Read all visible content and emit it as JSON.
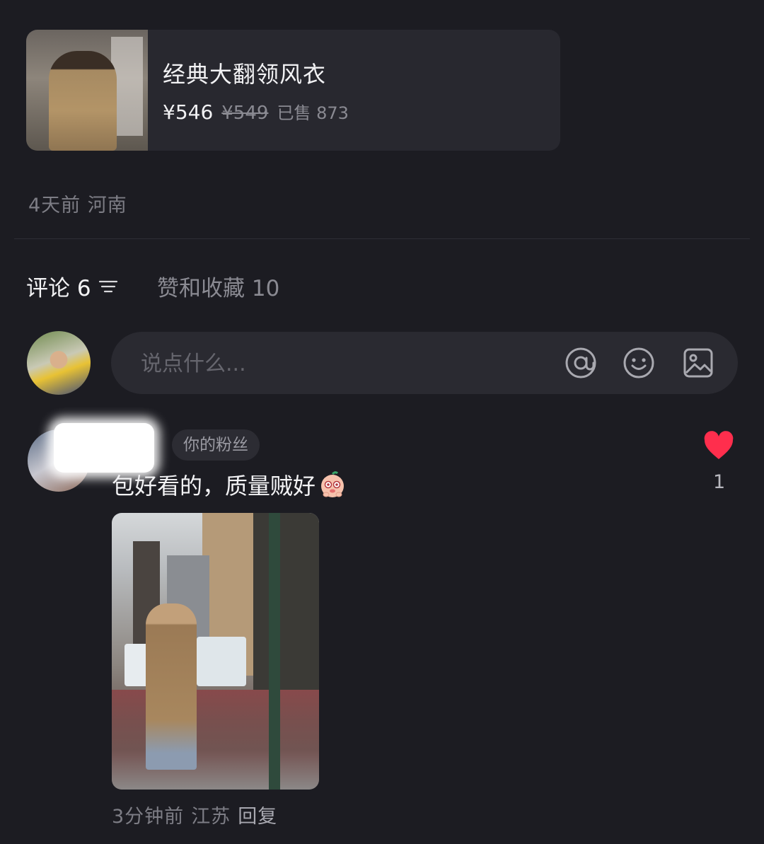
{
  "product": {
    "title": "经典大翻领风衣",
    "price": "¥546",
    "original_price": "¥549",
    "sold": "已售 873"
  },
  "post_meta": {
    "time": "4天前",
    "location": "河南"
  },
  "tabs": {
    "comments": "评论 6",
    "likes_favorites": "赞和收藏 10"
  },
  "composer": {
    "placeholder": "说点什么..."
  },
  "comment": {
    "badge": "你的粉丝",
    "text": "包好看的，质量贼好",
    "like_count": "1",
    "time": "3分钟前",
    "location": "江苏",
    "reply_label": "回复"
  },
  "colors": {
    "background": "#1c1c22",
    "card": "#28282f",
    "heart": "#ff2e4d"
  }
}
